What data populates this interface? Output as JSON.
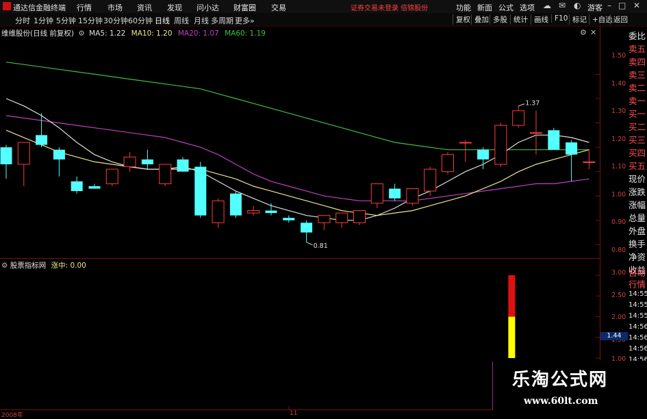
{
  "app": {
    "title": "通达信金融终端"
  },
  "menu": {
    "items": [
      "行情",
      "市场",
      "资讯",
      "发现",
      "问小达",
      "财富圈",
      "交易"
    ]
  },
  "notice": "证券交易未登录  倍锦股份",
  "top_right": {
    "items": [
      "功能",
      "新面",
      "公式",
      "选项"
    ],
    "user": "游客"
  },
  "periods": {
    "items": [
      "分时",
      "1分钟",
      "5分钟",
      "15分钟",
      "30分钟",
      "60分钟",
      "日线",
      "周线",
      "月线",
      "多周期",
      "更多»"
    ],
    "active": "日线"
  },
  "toolbar_buttons": [
    "复权",
    "叠加",
    "多股",
    "统计",
    "画线",
    "F10",
    "标记",
    "+自选",
    "返回"
  ],
  "main_chart": {
    "stock_title": "维维股份(日线 前复权)",
    "ma_labels": [
      {
        "text": "MA5: 1.22",
        "color": "#e0e0e0"
      },
      {
        "text": "MA10: 1.20",
        "color": "#f0e68c"
      },
      {
        "text": "MA20: 1.07",
        "color": "#c040c0"
      },
      {
        "text": "MA60: 1.19",
        "color": "#40c040"
      }
    ],
    "high_label": "1.37",
    "low_label": "0.81"
  },
  "sub_chart": {
    "title": "股票指标网",
    "indicator": "涨中: 0.00"
  },
  "colors": {
    "up": "#ff3c3c",
    "down": "#54ffff",
    "ma5": "#e0e0e0",
    "ma10": "#f0e68c",
    "ma20": "#c040c0",
    "ma60": "#40c040",
    "axis": "#d04040"
  },
  "bottom_axis": {
    "start_label": "2008年",
    "mid_label": "11"
  },
  "side_panel": {
    "labels": [
      "委比",
      "卖五",
      "卖四",
      "卖三",
      "卖二",
      "卖一",
      "买一",
      "买二",
      "买三",
      "买四",
      "买五",
      "现价",
      "涨跌",
      "涨幅",
      "总量",
      "外盘",
      "换手",
      "净资",
      "收益",
      "自动",
      "行情",
      "14:55",
      "14:55",
      "14:55",
      "14:56",
      "14:56",
      "14:56",
      "14:56"
    ],
    "price_tag": "1.44"
  },
  "watermark": {
    "title": "乐淘公式网",
    "url": "www.60lt.com"
  },
  "chart_data": {
    "type": "candlestick",
    "price_axis": {
      "ticks": [
        "1.50",
        "1.40",
        "1.30",
        "1.20",
        "1.10",
        "1.00",
        "0.90",
        "0.80"
      ],
      "ylim": [
        0.77,
        1.58
      ]
    },
    "sub_axis": {
      "ticks": [
        "3.00",
        "2.50",
        "2.00",
        "1.50",
        "1.00"
      ],
      "ylim": [
        0.95,
        3.2
      ]
    },
    "candles": [
      {
        "o": 1.2,
        "h": 1.21,
        "l": 1.07,
        "c": 1.13
      },
      {
        "o": 1.13,
        "h": 1.22,
        "l": 1.04,
        "c": 1.22
      },
      {
        "o": 1.25,
        "h": 1.34,
        "l": 1.2,
        "c": 1.21
      },
      {
        "o": 1.19,
        "h": 1.2,
        "l": 1.08,
        "c": 1.15
      },
      {
        "o": 1.06,
        "h": 1.08,
        "l": 1.01,
        "c": 1.02
      },
      {
        "o": 1.04,
        "h": 1.05,
        "l": 1.03,
        "c": 1.03
      },
      {
        "o": 1.05,
        "h": 1.11,
        "l": 1.04,
        "c": 1.11
      },
      {
        "o": 1.12,
        "h": 1.18,
        "l": 1.1,
        "c": 1.16
      },
      {
        "o": 1.15,
        "h": 1.19,
        "l": 1.11,
        "c": 1.13
      },
      {
        "o": 1.05,
        "h": 1.13,
        "l": 1.04,
        "c": 1.13
      },
      {
        "o": 1.15,
        "h": 1.16,
        "l": 1.1,
        "c": 1.1
      },
      {
        "o": 1.12,
        "h": 1.14,
        "l": 0.91,
        "c": 0.92
      },
      {
        "o": 0.89,
        "h": 0.99,
        "l": 0.87,
        "c": 0.98
      },
      {
        "o": 1.01,
        "h": 1.02,
        "l": 0.91,
        "c": 0.92
      },
      {
        "o": 0.93,
        "h": 0.96,
        "l": 0.92,
        "c": 0.94
      },
      {
        "o": 0.94,
        "h": 0.97,
        "l": 0.92,
        "c": 0.93
      },
      {
        "o": 0.91,
        "h": 0.92,
        "l": 0.89,
        "c": 0.9
      },
      {
        "o": 0.89,
        "h": 0.9,
        "l": 0.81,
        "c": 0.85
      },
      {
        "o": 0.89,
        "h": 0.92,
        "l": 0.86,
        "c": 0.92
      },
      {
        "o": 0.89,
        "h": 0.93,
        "l": 0.87,
        "c": 0.93
      },
      {
        "o": 0.89,
        "h": 0.94,
        "l": 0.88,
        "c": 0.94
      },
      {
        "o": 0.97,
        "h": 1.05,
        "l": 0.95,
        "c": 1.05
      },
      {
        "o": 1.03,
        "h": 1.05,
        "l": 0.98,
        "c": 0.99
      },
      {
        "o": 0.97,
        "h": 1.03,
        "l": 0.96,
        "c": 1.03
      },
      {
        "o": 1.02,
        "h": 1.12,
        "l": 1.0,
        "c": 1.11
      },
      {
        "o": 1.1,
        "h": 1.18,
        "l": 1.09,
        "c": 1.17
      },
      {
        "o": 1.22,
        "h": 1.23,
        "l": 1.14,
        "c": 1.22
      },
      {
        "o": 1.19,
        "h": 1.2,
        "l": 1.11,
        "c": 1.15
      },
      {
        "o": 1.13,
        "h": 1.3,
        "l": 1.12,
        "c": 1.29
      },
      {
        "o": 1.29,
        "h": 1.37,
        "l": 1.28,
        "c": 1.35
      },
      {
        "o": 1.26,
        "h": 1.35,
        "l": 1.17,
        "c": 1.26
      },
      {
        "o": 1.27,
        "h": 1.28,
        "l": 1.19,
        "c": 1.19
      },
      {
        "o": 1.22,
        "h": 1.23,
        "l": 1.06,
        "c": 1.17
      },
      {
        "o": 1.14,
        "h": 1.19,
        "l": 1.11,
        "c": 1.14
      }
    ],
    "ma5": [
      1.4,
      1.37,
      1.33,
      1.28,
      1.22,
      1.17,
      1.14,
      1.12,
      1.11,
      1.11,
      1.12,
      1.1,
      1.06,
      1.02,
      0.99,
      0.96,
      0.94,
      0.92,
      0.91,
      0.9,
      0.9,
      0.92,
      0.95,
      0.99,
      1.02,
      1.06,
      1.1,
      1.13,
      1.17,
      1.22,
      1.25,
      1.25,
      1.24,
      1.22
    ],
    "ma10": [
      1.27,
      1.24,
      1.21,
      1.18,
      1.16,
      1.14,
      1.13,
      1.12,
      1.11,
      1.11,
      1.11,
      1.11,
      1.09,
      1.07,
      1.04,
      1.02,
      1.0,
      0.98,
      0.96,
      0.94,
      0.93,
      0.92,
      0.93,
      0.94,
      0.96,
      0.98,
      1.0,
      1.03,
      1.06,
      1.1,
      1.13,
      1.15,
      1.17,
      1.19
    ],
    "ma20": [
      1.33,
      1.32,
      1.31,
      1.3,
      1.29,
      1.28,
      1.27,
      1.26,
      1.25,
      1.24,
      1.22,
      1.2,
      1.17,
      1.13,
      1.09,
      1.06,
      1.04,
      1.02,
      1.0,
      0.99,
      0.98,
      0.98,
      0.98,
      0.98,
      0.99,
      1.0,
      1.01,
      1.02,
      1.03,
      1.04,
      1.05,
      1.05,
      1.06,
      1.07
    ],
    "ma60": [
      1.55,
      1.54,
      1.53,
      1.52,
      1.51,
      1.5,
      1.49,
      1.48,
      1.47,
      1.46,
      1.45,
      1.44,
      1.42,
      1.4,
      1.38,
      1.36,
      1.34,
      1.32,
      1.3,
      1.28,
      1.26,
      1.24,
      1.22,
      1.21,
      1.2,
      1.19,
      1.19,
      1.19,
      1.19,
      1.19,
      1.19,
      1.19,
      1.19,
      1.19
    ],
    "sub_bars": [
      {
        "index": 28,
        "low": 1.0,
        "high": 2.0,
        "color": "#ffff00"
      },
      {
        "index": 28,
        "low": 2.0,
        "high": 3.0,
        "color": "#e01010"
      }
    ]
  }
}
